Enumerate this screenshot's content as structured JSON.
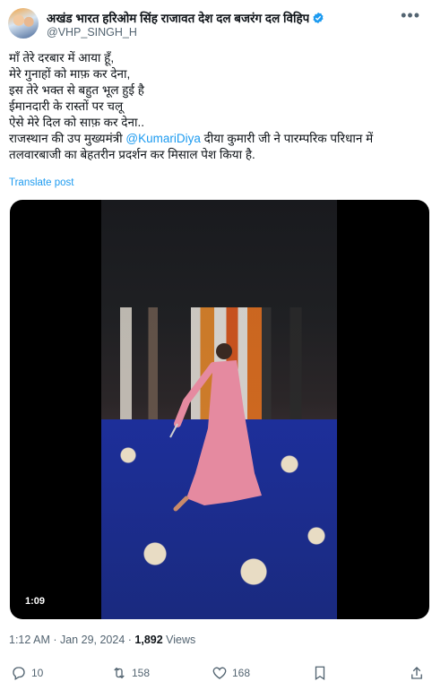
{
  "author": {
    "display_name": "अखंड भारत हरिओम सिंह राजावत देश दल बजरंग दल विहिप",
    "handle": "@VHP_SINGH_H",
    "verified_color": "#1d9bf0"
  },
  "tweet": {
    "lines": [
      "माँ तेरे दरबार में आया हूँ,",
      "मेरे गुनाहों को माफ़ कर देना,",
      "इस तेरे भक्त से बहुत भूल हुई है",
      "ईमानदारी के रास्तों पर चलू",
      "ऐसे मेरे दिल को साफ़ कर देना..",
      "राजस्थान की उप मुख्यमंत्री ",
      "तलवारबाजी का बेहतरीन प्रदर्शन कर मिसाल पेश किया है."
    ],
    "mention": "@KumariDiya",
    "after_mention": "  दीया कुमारी जी ने पारम्परिक परिधान में",
    "translate_label": "Translate post"
  },
  "media": {
    "duration": "1:09"
  },
  "meta": {
    "time": "1:12 AM",
    "separator": " · ",
    "date": "Jan 29, 2024",
    "views_count": "1,892",
    "views_label": " Views"
  },
  "actions": {
    "replies": "10",
    "reposts": "158",
    "likes": "168"
  },
  "icons": [
    "more-icon",
    "verified-icon",
    "reply-icon",
    "repost-icon",
    "like-icon",
    "bookmark-icon",
    "share-icon"
  ]
}
